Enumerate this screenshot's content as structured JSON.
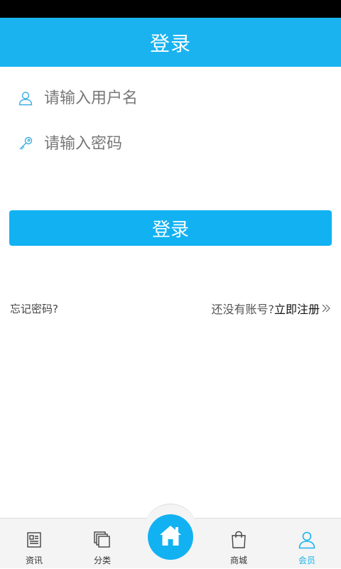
{
  "header": {
    "title": "登录"
  },
  "form": {
    "username_placeholder": "请输入用户名",
    "password_placeholder": "请输入密码",
    "login_label": "登录"
  },
  "links": {
    "forgot": "忘记密码?",
    "no_account": "还没有账号?",
    "register": "立即注册"
  },
  "tabbar": {
    "items": [
      {
        "label": "资讯",
        "icon": "newspaper-icon"
      },
      {
        "label": "分类",
        "icon": "stack-icon"
      },
      {
        "label": "",
        "icon": "home-icon"
      },
      {
        "label": "商城",
        "icon": "shopping-bag-icon"
      },
      {
        "label": "会员",
        "icon": "user-icon",
        "active": true
      }
    ]
  },
  "colors": {
    "accent": "#12b2f2",
    "header": "#1ab3f0"
  }
}
